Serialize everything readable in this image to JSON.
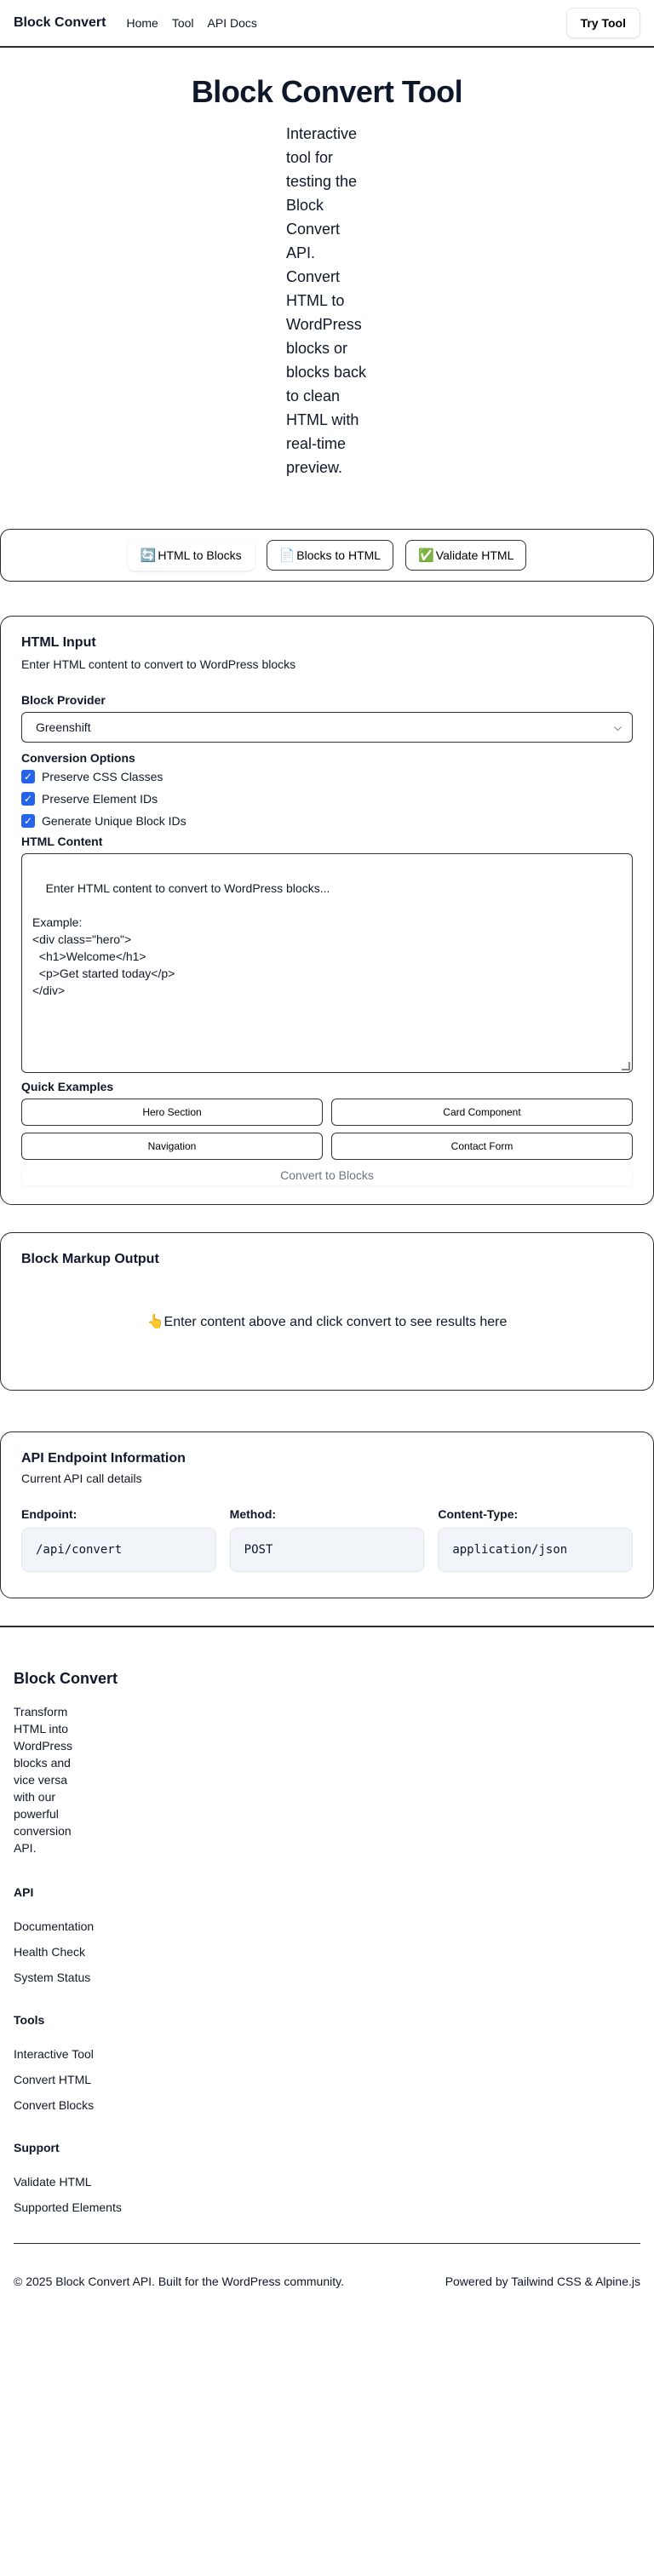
{
  "header": {
    "brand": "Block Convert",
    "nav": [
      "Home",
      "Tool",
      "API Docs"
    ],
    "try_button": "Try Tool"
  },
  "hero": {
    "title": "Block Convert Tool",
    "description": "Interactive tool for testing the Block Convert API. Convert HTML to WordPress blocks or blocks back to clean HTML with real-time preview."
  },
  "tabs": [
    {
      "icon": "🔄",
      "icon_name": "arrows-cycle-icon",
      "label": "HTML to Blocks"
    },
    {
      "icon": "📄",
      "icon_name": "document-icon",
      "label": "Blocks to HTML"
    },
    {
      "icon": "✅",
      "icon_name": "check-mark-icon",
      "label": "Validate HTML"
    }
  ],
  "input_card": {
    "title": "HTML Input",
    "subtitle": "Enter HTML content to convert to WordPress blocks",
    "provider_label": "Block Provider",
    "provider_value": "Greenshift",
    "options_label": "Conversion Options",
    "options": [
      "Preserve CSS Classes",
      "Preserve Element IDs",
      "Generate Unique Block IDs"
    ],
    "content_label": "HTML Content",
    "placeholder": "Enter HTML content to convert to WordPress blocks...\n\nExample:\n<div class=\"hero\">\n  <h1>Welcome</h1>\n  <p>Get started today</p>\n</div>",
    "quick_label": "Quick Examples",
    "quick_examples": [
      "Hero Section",
      "Card Component",
      "Navigation",
      "Contact Form"
    ],
    "convert_button": "Convert to Blocks"
  },
  "output_card": {
    "title": "Block Markup Output",
    "icon": "👆",
    "message": "Enter content above and click convert to see results here"
  },
  "api_card": {
    "title": "API Endpoint Information",
    "subtitle": "Current API call details",
    "fields": [
      {
        "label": "Endpoint:",
        "value": "/api/convert"
      },
      {
        "label": "Method:",
        "value": "POST"
      },
      {
        "label": "Content-Type:",
        "value": "application/json"
      }
    ]
  },
  "footer": {
    "brand": "Block Convert",
    "description": "Transform HTML into WordPress blocks and vice versa with our powerful conversion API.",
    "sections": [
      {
        "heading": "API",
        "links": [
          "Documentation",
          "Health Check",
          "System Status"
        ]
      },
      {
        "heading": "Tools",
        "links": [
          "Interactive Tool",
          "Convert HTML",
          "Convert Blocks"
        ]
      },
      {
        "heading": "Support",
        "links": [
          "Validate HTML",
          "Supported Elements"
        ]
      }
    ],
    "copyright": "© 2025 Block Convert API. Built for the WordPress community.",
    "powered_by": "Powered by Tailwind CSS & Alpine.js"
  }
}
